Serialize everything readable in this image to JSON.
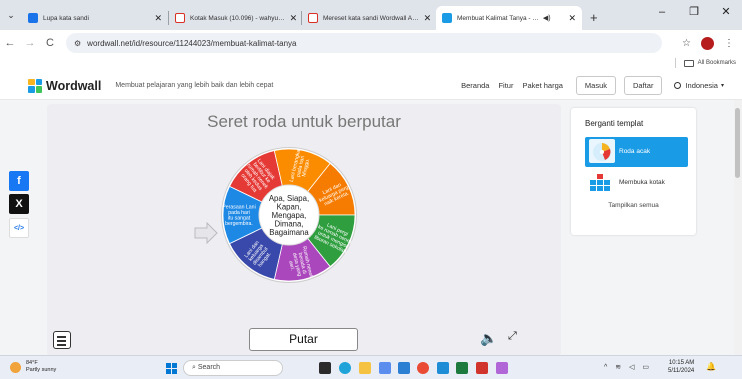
{
  "tabs": [
    {
      "title": "Lupa kata sandi",
      "color": "#1a73e8",
      "active": false
    },
    {
      "title": "Kotak Masuk (10.096) - wahyu…",
      "color": "#d93025",
      "active": false
    },
    {
      "title": "Mereset kata sandi Wordwall A…",
      "color": "#d93025",
      "active": false
    },
    {
      "title": "Membuat Kalimat Tanya - …",
      "color": "#1a9be6",
      "active": true
    }
  ],
  "new_tab": "+",
  "window_controls": {
    "minimize": "–",
    "maximize": "❐",
    "close": "✕"
  },
  "address_bar": {
    "url": "wordwall.net/id/resource/11244023/membuat-kalimat-tanya",
    "back": "←",
    "forward": "→",
    "reload": "C",
    "star": "☆",
    "menu": "⋮"
  },
  "bookmarks": {
    "all_bookmarks": "All Bookmarks"
  },
  "site": {
    "logo": "Wordwall",
    "tagline": "Membuat pelajaran yang lebih baik dan lebih cepat",
    "nav": {
      "home": "Beranda",
      "features": "Fitur",
      "pricing": "Paket harga",
      "login": "Masuk",
      "register": "Daftar",
      "language": "Indonesia"
    }
  },
  "game": {
    "title": "Seret roda untuk berputar",
    "center_text": [
      "Apa, Siapa,",
      "Kapan,",
      "Mengapa,",
      "Dimana,",
      "Bagaimana"
    ],
    "highlighted_segment": [
      "Perasaan Lani",
      "pada hari",
      "itu sangat",
      "bergembira."
    ],
    "segments": [
      {
        "color": "#e53935",
        "text": [
          "Lani diajak",
          "berlibur ke",
          "rumah nenek",
          "oleh kedua",
          "orang tua"
        ]
      },
      {
        "color": "#fb8c00",
        "text": [
          "Lani berangkat",
          "pada hari",
          "Minggu."
        ]
      },
      {
        "color": "#f57c00",
        "text": [
          "Lani dan",
          "keluarga pergi",
          "naik kereta."
        ]
      },
      {
        "color": "#2e9e3e",
        "text": [
          "Lani pergi",
          "ke rumah nenek",
          "untuk mengisi",
          "liburan sekolah"
        ]
      },
      {
        "color": "#ab47bc",
        "text": [
          "Rumah nenek",
          "berada di",
          "desa yang",
          "asri."
        ]
      },
      {
        "color": "#3949ab",
        "text": [
          "Lani dan",
          "keluarga",
          "disambut",
          "hangat."
        ]
      },
      {
        "color": "#1e88e5",
        "text": [
          "Perasaan Lani",
          "pada hari",
          "itu sangat",
          "bergembira."
        ]
      }
    ],
    "spin_button": "Putar",
    "sound_icon": "🔈",
    "fullscreen_icon": "⤢"
  },
  "share": [
    {
      "name": "facebook",
      "glyph": "f",
      "color": "#1877f2"
    },
    {
      "name": "x",
      "glyph": "X",
      "color": "#111111"
    },
    {
      "name": "embed",
      "glyph": "</>",
      "color": "#ffffff"
    }
  ],
  "panel": {
    "title": "Berganti templat",
    "templates": [
      {
        "label": "Roda acak",
        "active": true
      },
      {
        "label": "Membuka kotak",
        "active": false
      }
    ],
    "show_all": "Tampilkan semua"
  },
  "taskbar": {
    "weather_temp": "84°F",
    "weather_desc": "Partly sunny",
    "search": "Search",
    "time": "10:15 AM",
    "date": "5/11/2024"
  }
}
